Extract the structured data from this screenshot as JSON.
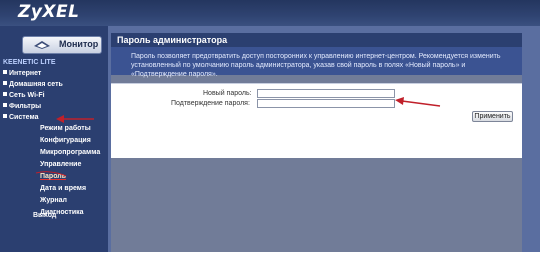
{
  "brand": {
    "logo_text": "ZyXEL"
  },
  "sidebar": {
    "monitor_label": "Монитор",
    "device_name": "KEENETIC LITE",
    "items": [
      {
        "label": "Интернет"
      },
      {
        "label": "Домашняя сеть"
      },
      {
        "label": "Сеть Wi-Fi"
      },
      {
        "label": "Фильтры"
      },
      {
        "label": "Система"
      }
    ],
    "system_subitems": [
      {
        "label": "Режим работы"
      },
      {
        "label": "Конфигурация"
      },
      {
        "label": "Микропрограмма"
      },
      {
        "label": "Управление"
      },
      {
        "label": "Пароль",
        "active": true
      },
      {
        "label": "Дата и время"
      },
      {
        "label": "Журнал"
      },
      {
        "label": "Диагностика"
      }
    ],
    "exit_label": "Выход"
  },
  "main": {
    "title": "Пароль администратора",
    "description": "Пароль позволяет предотвратить доступ посторонних к управлению интернет-центром. Рекомендуется изменить установленный по умолчанию пароль администратора, указав свой пароль в полях «Новый пароль» и «Подтверждение пароля».",
    "form": {
      "new_password_label": "Новый пароль:",
      "new_password_value": "",
      "confirm_label": "Подтверждение пароля:",
      "confirm_value": "",
      "apply_label": "Применить"
    }
  },
  "colors": {
    "header_bg": "#2b3f70",
    "description_bg": "#3b5392",
    "annotation_arrow": "#c0202a"
  },
  "icons": {
    "monitor": "monitor-icon",
    "bullet": "square-bullet-icon"
  }
}
